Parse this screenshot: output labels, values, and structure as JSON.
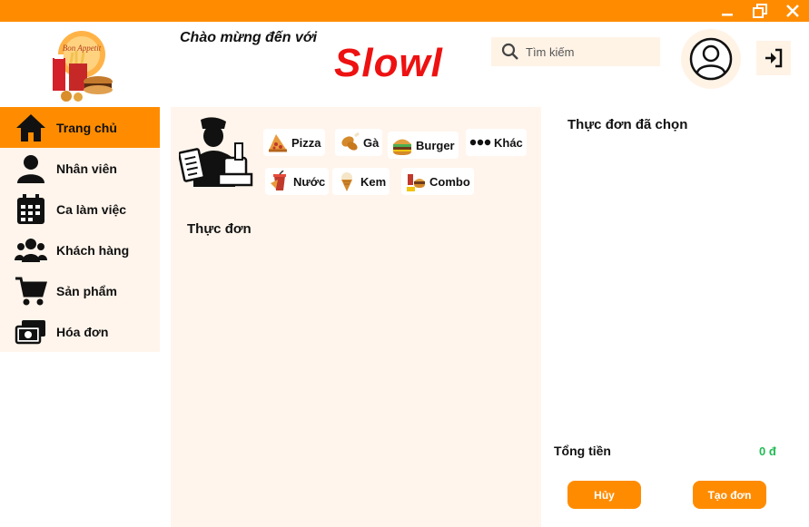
{
  "header": {
    "welcome": "Chào mừng đến với",
    "brand": "Slowl",
    "logo_text": "Bon Appetit",
    "search_placeholder": "Tìm kiếm"
  },
  "window_controls": {
    "minimize_icon": "minimize-icon",
    "restore_icon": "restore-icon",
    "close_icon": "close-icon"
  },
  "sidebar": {
    "items": [
      {
        "label": "Trang chủ",
        "icon": "home-icon",
        "active": true
      },
      {
        "label": "Nhân viên",
        "icon": "user-icon",
        "active": false
      },
      {
        "label": "Ca làm việc",
        "icon": "calendar-icon",
        "active": false
      },
      {
        "label": "Khách hàng",
        "icon": "users-icon",
        "active": false
      },
      {
        "label": "Sản phẩm",
        "icon": "cart-icon",
        "active": false
      },
      {
        "label": "Hóa đơn",
        "icon": "money-icon",
        "active": false
      }
    ]
  },
  "categories": [
    {
      "label": "Pizza",
      "icon": "pizza-icon"
    },
    {
      "label": "Gà",
      "icon": "chicken-icon"
    },
    {
      "label": "Burger",
      "icon": "burger-icon"
    },
    {
      "label": "Khác",
      "icon": "more-icon"
    },
    {
      "label": "Nước",
      "icon": "drink-icon"
    },
    {
      "label": "Kem",
      "icon": "ice-cream-icon"
    },
    {
      "label": "Combo",
      "icon": "combo-icon"
    }
  ],
  "menu": {
    "title": "Thực đơn"
  },
  "order": {
    "title": "Thực đơn đã chọn",
    "total_label": "Tổng tiền",
    "total_value": "0 đ",
    "cancel_label": "Hủy",
    "create_label": "Tạo đơn"
  },
  "colors": {
    "accent": "#ff8c00",
    "brand": "#ee1111",
    "panel": "#fff5ec",
    "total": "#22bb55"
  }
}
